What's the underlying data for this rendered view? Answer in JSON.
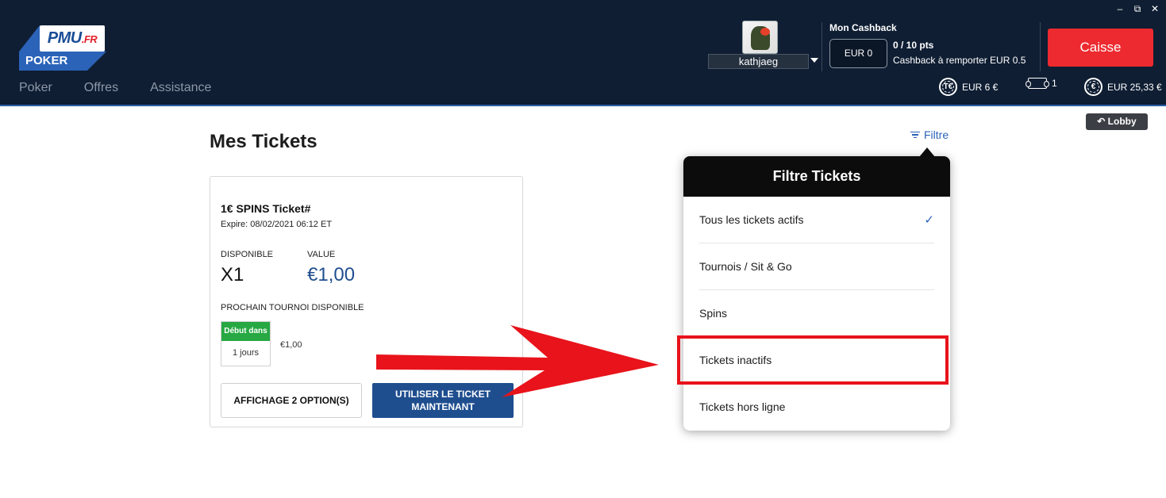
{
  "window_controls": {
    "minimize": "–",
    "restore": "⧉",
    "close": "✕"
  },
  "brand": {
    "logo_main": "PMU",
    "logo_suffix": ".FR",
    "logo_sub": "POKER"
  },
  "nav": {
    "items": [
      "Poker",
      "Offres",
      "Assistance"
    ]
  },
  "user": {
    "name": "kathjaeg",
    "avatar_icon": "player-avatar-icon"
  },
  "cashback": {
    "title": "Mon Cashback",
    "amount": "EUR 0",
    "points": "0 / 10 pts",
    "info": "Cashback à remporter EUR 0.5"
  },
  "caisse_label": "Caisse",
  "balances": {
    "t_coin_label": "T€",
    "t_amount": "EUR 6 €",
    "tickets_count": "1",
    "euro_coin_label": "€",
    "cash_amount": "EUR 25,33 €"
  },
  "lobby_label": "↶ Lobby",
  "page": {
    "title": "Mes Tickets",
    "filter_label": "Filtre"
  },
  "ticket": {
    "name": "1€ SPINS Ticket#",
    "expire": "Expire: 08/02/2021   06:12 ET",
    "available_label": "DISPONIBLE",
    "available_value": "X1",
    "value_label": "VALUE",
    "value_value": "€1,00",
    "next_label": "PROCHAIN TOURNOI DISPONIBLE",
    "badge_top": "Début dans",
    "badge_bottom": "1 jours",
    "tournament_price": "€1,00",
    "options_button": "AFFICHAGE 2 OPTION(S)",
    "use_button_line1": "UTILISER LE TICKET",
    "use_button_line2": "MAINTENANT"
  },
  "filter_dropdown": {
    "title": "Filtre Tickets",
    "items": [
      {
        "label": "Tous les tickets actifs",
        "checked": "✓"
      },
      {
        "label": "Tournois / Sit & Go"
      },
      {
        "label": "Spins"
      },
      {
        "label": "Tickets inactifs"
      },
      {
        "label": "Tickets hors ligne"
      }
    ]
  },
  "colors": {
    "header_bg": "#0f1e33",
    "caisse_red": "#ed2a2f",
    "brand_blue": "#1f4e8f",
    "link_blue": "#2c63b8",
    "badge_green": "#27a843",
    "annotation_red": "#e8131b"
  }
}
